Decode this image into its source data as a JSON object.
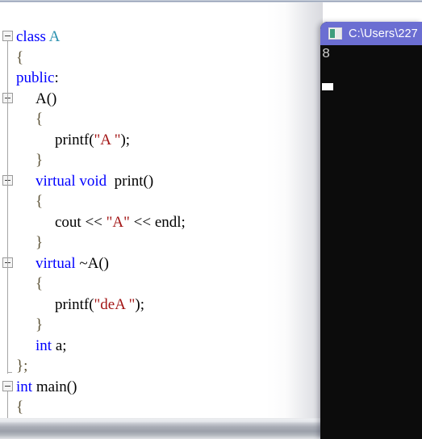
{
  "window": {
    "title": "code-editor-with-console"
  },
  "editor": {
    "name": "cpp-source-editor",
    "language": "C++",
    "lines": [
      {
        "indent": 0,
        "fold": "open",
        "tokens": [
          {
            "t": "class ",
            "c": "kw"
          },
          {
            "t": "A",
            "c": "cls"
          }
        ]
      },
      {
        "indent": 0,
        "fold": "pipe",
        "tokens": [
          {
            "t": "{",
            "c": "br"
          }
        ]
      },
      {
        "indent": 0,
        "fold": "pipe",
        "tokens": [
          {
            "t": "public",
            "c": "kw"
          },
          {
            "t": ":",
            "c": "pl"
          }
        ]
      },
      {
        "indent": 1,
        "fold": "open",
        "tokens": [
          {
            "t": "A()",
            "c": "pl"
          }
        ]
      },
      {
        "indent": 1,
        "fold": "pipe",
        "tokens": [
          {
            "t": "{",
            "c": "br"
          }
        ]
      },
      {
        "indent": 2,
        "fold": "pipe",
        "tokens": [
          {
            "t": "printf(",
            "c": "pl"
          },
          {
            "t": "\"A \"",
            "c": "str"
          },
          {
            "t": ");",
            "c": "pl"
          }
        ]
      },
      {
        "indent": 1,
        "fold": "pipe",
        "tokens": [
          {
            "t": "}",
            "c": "br"
          }
        ]
      },
      {
        "indent": 1,
        "fold": "open",
        "tokens": [
          {
            "t": "virtual",
            "c": "kw"
          },
          {
            "t": " ",
            "c": "pl"
          },
          {
            "t": "void",
            "c": "kw"
          },
          {
            "t": "  print()",
            "c": "pl"
          }
        ]
      },
      {
        "indent": 1,
        "fold": "pipe",
        "tokens": [
          {
            "t": "{",
            "c": "br"
          }
        ]
      },
      {
        "indent": 2,
        "fold": "pipe",
        "tokens": [
          {
            "t": "cout << ",
            "c": "pl"
          },
          {
            "t": "\"A\"",
            "c": "str"
          },
          {
            "t": " << endl;",
            "c": "pl"
          }
        ]
      },
      {
        "indent": 1,
        "fold": "pipe",
        "tokens": [
          {
            "t": "}",
            "c": "br"
          }
        ]
      },
      {
        "indent": 1,
        "fold": "open",
        "tokens": [
          {
            "t": "virtual",
            "c": "kw"
          },
          {
            "t": " ~A()",
            "c": "pl"
          }
        ]
      },
      {
        "indent": 1,
        "fold": "pipe",
        "tokens": [
          {
            "t": "{",
            "c": "br"
          }
        ]
      },
      {
        "indent": 2,
        "fold": "pipe",
        "tokens": [
          {
            "t": "printf(",
            "c": "pl"
          },
          {
            "t": "\"deA \"",
            "c": "str"
          },
          {
            "t": ");",
            "c": "pl"
          }
        ]
      },
      {
        "indent": 1,
        "fold": "pipe",
        "tokens": [
          {
            "t": "}",
            "c": "br"
          }
        ]
      },
      {
        "indent": 1,
        "fold": "pipe",
        "tokens": [
          {
            "t": "int",
            "c": "kw"
          },
          {
            "t": " a;",
            "c": "pl"
          }
        ]
      },
      {
        "indent": 0,
        "fold": "end",
        "tokens": [
          {
            "t": "};",
            "c": "br"
          }
        ]
      },
      {
        "indent": 0,
        "fold": "open",
        "tokens": [
          {
            "t": "int",
            "c": "kw"
          },
          {
            "t": " main()",
            "c": "pl"
          }
        ]
      },
      {
        "indent": 0,
        "fold": "pipe",
        "tokens": [
          {
            "t": "{",
            "c": "br"
          }
        ]
      }
    ],
    "colors": {
      "keyword": "#0000ff",
      "class_name": "#2b91af",
      "string": "#a31515",
      "brace": "#5c5236",
      "plain": "#000000",
      "background": "#ffffff"
    }
  },
  "console": {
    "name": "windows-console",
    "title": "C:\\Users\\227",
    "icon": "console-window-icon",
    "output": "8",
    "cursor_visible": true,
    "colors": {
      "titlebar": "#6b6ed2",
      "background": "#0c0c0c",
      "text": "#cccccc"
    }
  },
  "scrollbar": {
    "name": "horizontal-scrollbar",
    "orientation": "horizontal",
    "position": 0
  }
}
